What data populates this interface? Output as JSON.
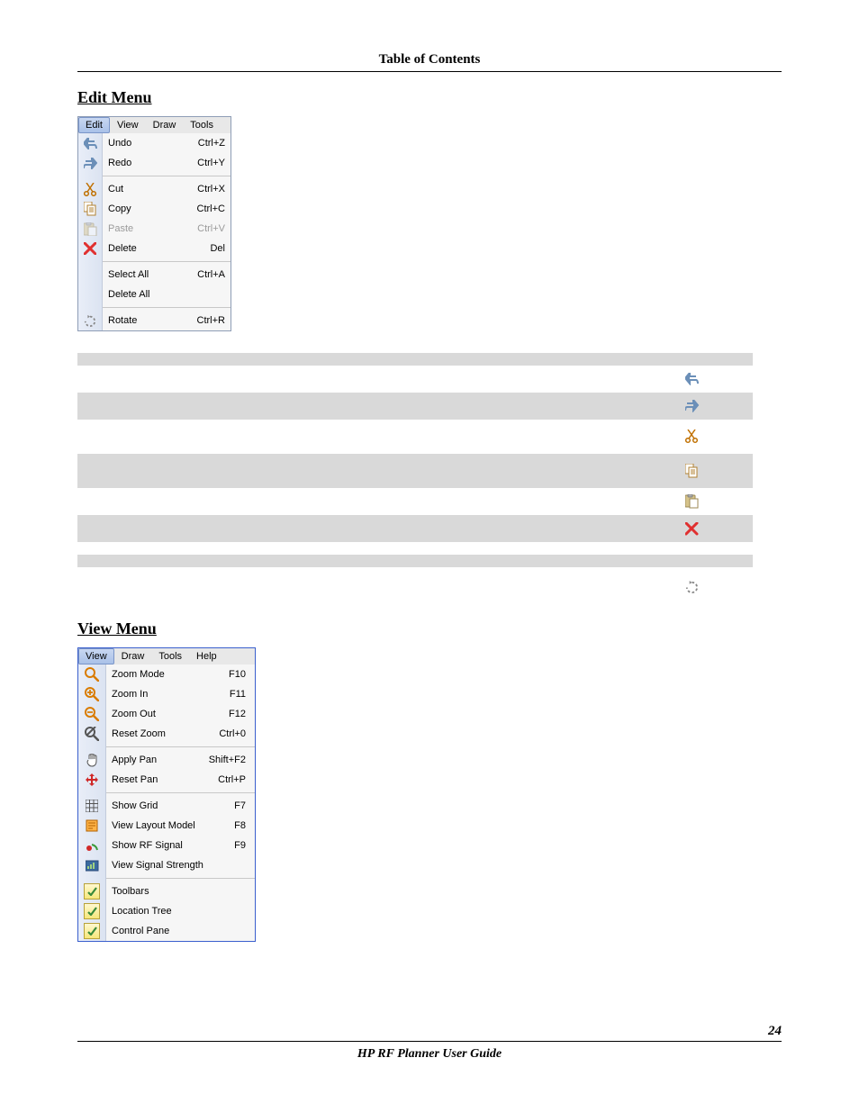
{
  "header": {
    "toc": "Table of Contents"
  },
  "sections": {
    "edit_heading": "Edit Menu",
    "view_heading": "View Menu"
  },
  "edit_menu": {
    "tabs": {
      "edit": "Edit",
      "view": "View",
      "draw": "Draw",
      "tools": "Tools"
    },
    "items": {
      "undo": {
        "label": "Undo",
        "accel": "Ctrl+Z"
      },
      "redo": {
        "label": "Redo",
        "accel": "Ctrl+Y"
      },
      "cut": {
        "label": "Cut",
        "accel": "Ctrl+X"
      },
      "copy": {
        "label": "Copy",
        "accel": "Ctrl+C"
      },
      "paste": {
        "label": "Paste",
        "accel": "Ctrl+V"
      },
      "delete": {
        "label": "Delete",
        "accel": "Del"
      },
      "select_all": {
        "label": "Select All",
        "accel": "Ctrl+A"
      },
      "delete_all": {
        "label": "Delete All",
        "accel": ""
      },
      "rotate": {
        "label": "Rotate",
        "accel": "Ctrl+R"
      }
    }
  },
  "view_menu": {
    "tabs": {
      "view": "View",
      "draw": "Draw",
      "tools": "Tools",
      "help": "Help"
    },
    "items": {
      "zoom_mode": {
        "label": "Zoom Mode",
        "accel": "F10"
      },
      "zoom_in": {
        "label": "Zoom In",
        "accel": "F11"
      },
      "zoom_out": {
        "label": "Zoom Out",
        "accel": "F12"
      },
      "reset_zoom": {
        "label": "Reset Zoom",
        "accel": "Ctrl+0"
      },
      "apply_pan": {
        "label": "Apply Pan",
        "accel": "Shift+F2"
      },
      "reset_pan": {
        "label": "Reset Pan",
        "accel": "Ctrl+P"
      },
      "show_grid": {
        "label": "Show Grid",
        "accel": "F7"
      },
      "layout": {
        "label": "View Layout Model",
        "accel": "F8"
      },
      "rf_signal": {
        "label": "Show RF Signal",
        "accel": "F9"
      },
      "sig_str": {
        "label": "View Signal Strength",
        "accel": ""
      },
      "toolbars": {
        "label": "Toolbars",
        "accel": ""
      },
      "loc_tree": {
        "label": "Location Tree",
        "accel": ""
      },
      "ctrl_pane": {
        "label": "Control Pane",
        "accel": ""
      }
    }
  },
  "footer": {
    "page_number": "24",
    "doc_title": "HP RF Planner User Guide"
  }
}
